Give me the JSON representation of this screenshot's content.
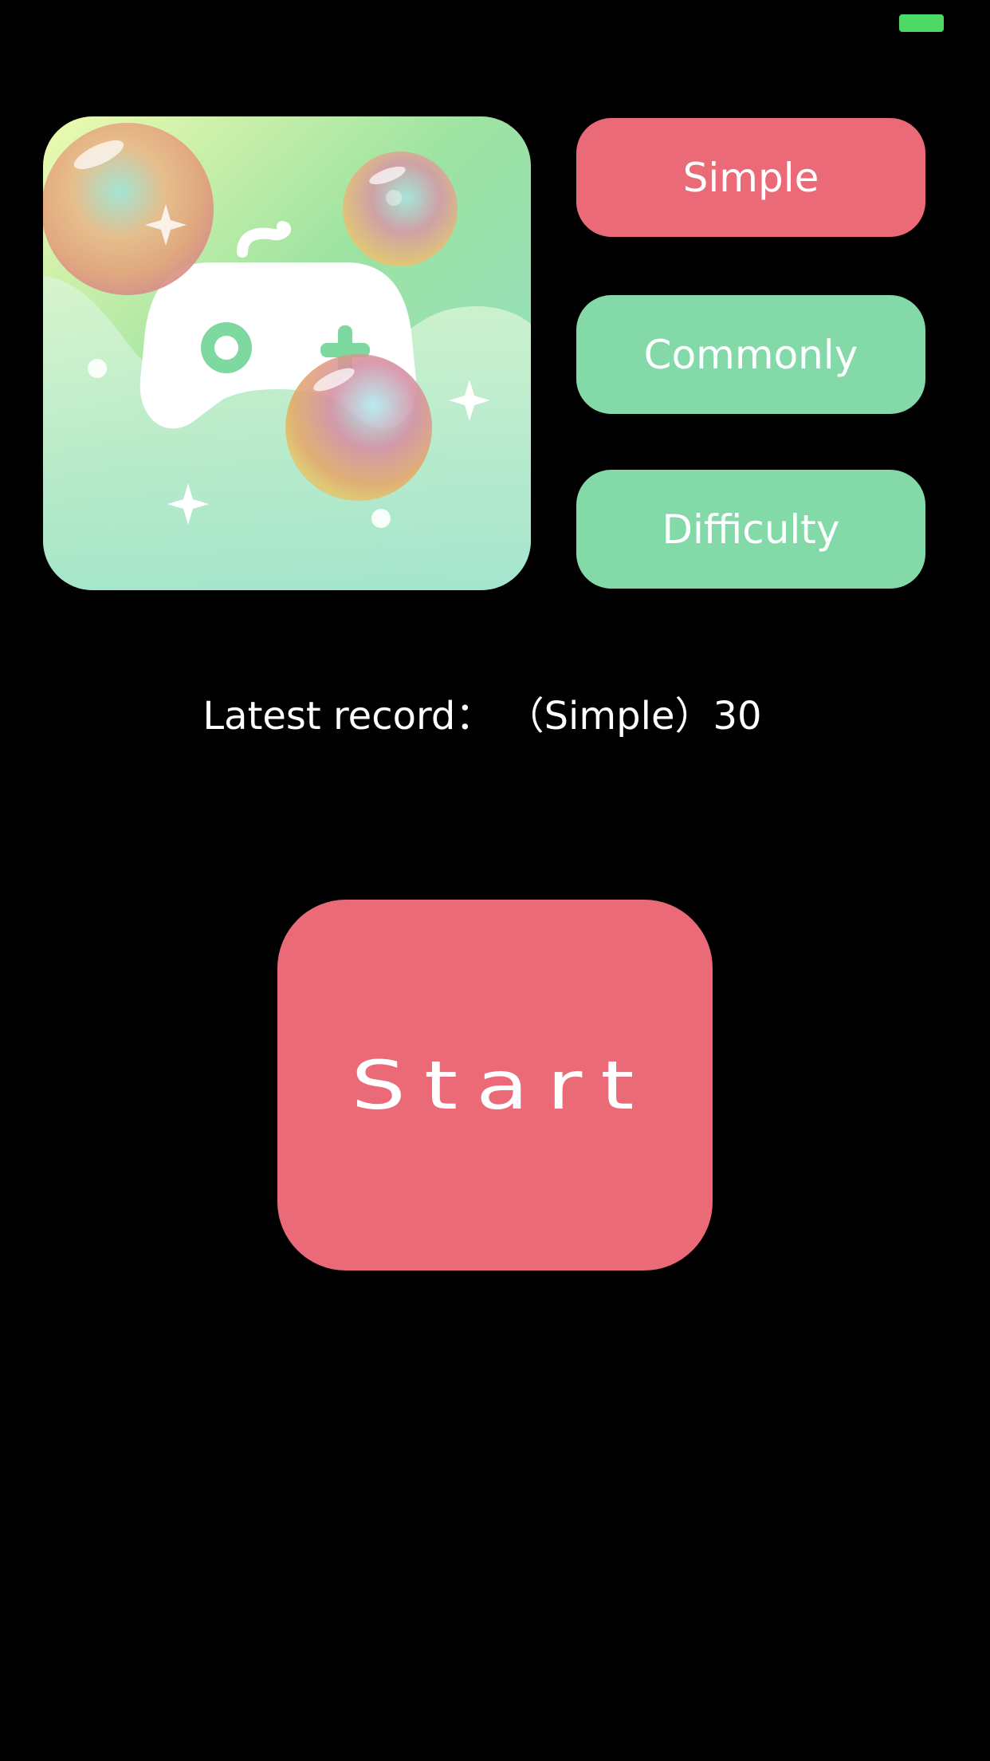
{
  "status_bar": {
    "battery_color": "#4cd964"
  },
  "hero": {
    "icon": "game-controller-bubbles-icon"
  },
  "levels": {
    "simple_label": "Simple",
    "commonly_label": "Commonly",
    "difficulty_label": "Difficulty",
    "selected": "Simple"
  },
  "record": {
    "text": "Latest record： （Simple）30"
  },
  "start": {
    "label": "Start"
  },
  "colors": {
    "selected": "#ea6a78",
    "unselected": "#84d9a8",
    "background": "#000000"
  }
}
